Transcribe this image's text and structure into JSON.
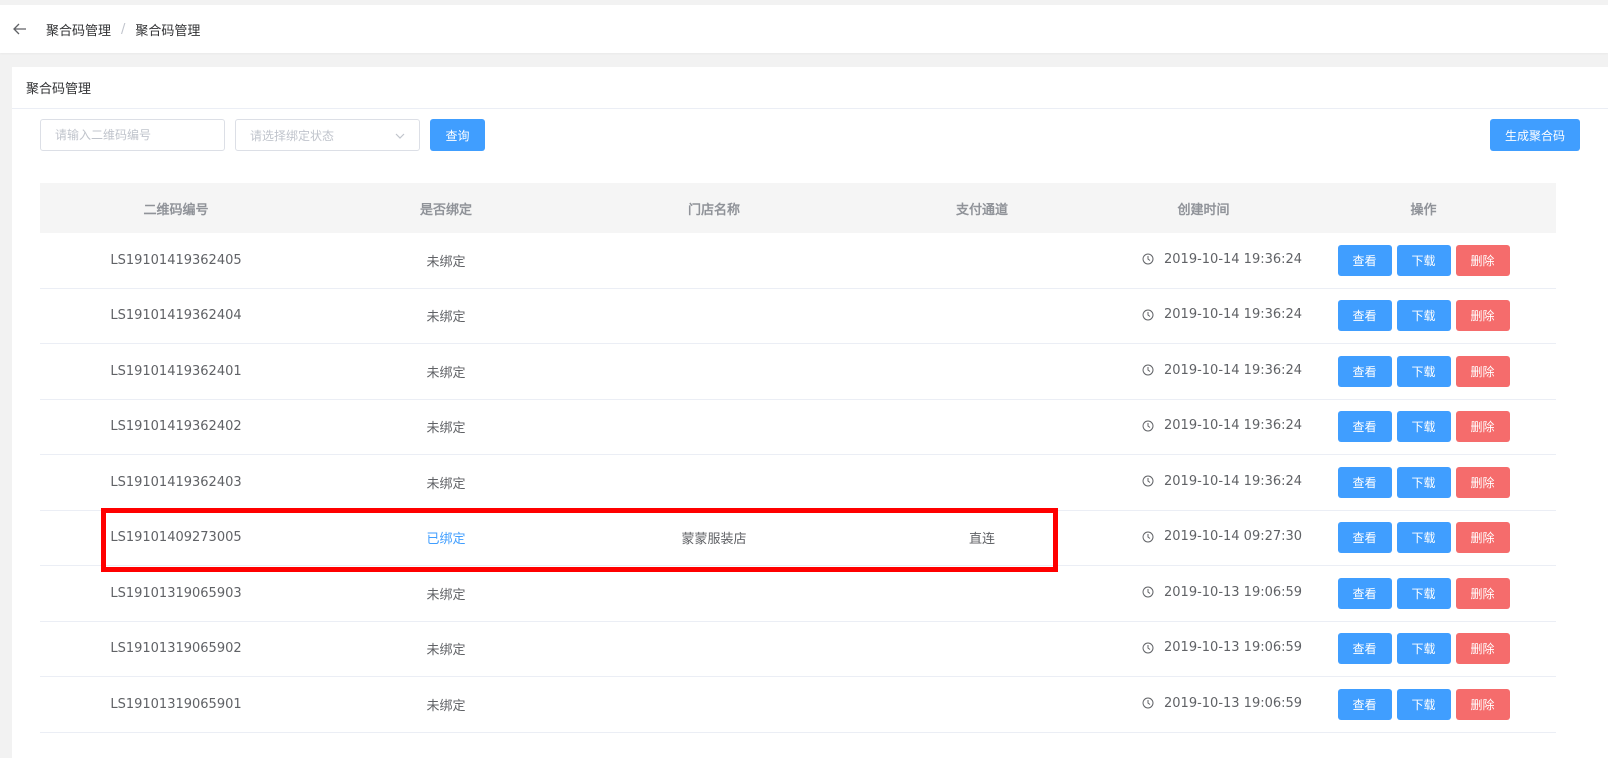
{
  "breadcrumb": {
    "items": [
      "聚合码管理",
      "聚合码管理"
    ],
    "separator": "/"
  },
  "card": {
    "title": "聚合码管理"
  },
  "filters": {
    "code_placeholder": "请输入二维码编号",
    "status_placeholder": "请选择绑定状态",
    "query_label": "查询",
    "generate_label": "生成聚合码"
  },
  "table": {
    "headers": [
      "二维码编号",
      "是否绑定",
      "门店名称",
      "支付通道",
      "创建时间",
      "操作"
    ],
    "rows": [
      {
        "code": "LS19101419362405",
        "status": "未绑定",
        "store": "",
        "channel": "",
        "created": "2019-10-14 19:36:24"
      },
      {
        "code": "LS19101419362404",
        "status": "未绑定",
        "store": "",
        "channel": "",
        "created": "2019-10-14 19:36:24"
      },
      {
        "code": "LS19101419362401",
        "status": "未绑定",
        "store": "",
        "channel": "",
        "created": "2019-10-14 19:36:24"
      },
      {
        "code": "LS19101419362402",
        "status": "未绑定",
        "store": "",
        "channel": "",
        "created": "2019-10-14 19:36:24"
      },
      {
        "code": "LS19101419362403",
        "status": "未绑定",
        "store": "",
        "channel": "",
        "created": "2019-10-14 19:36:24"
      },
      {
        "code": "LS19101409273005",
        "status": "已绑定",
        "store": "蒙蒙服装店",
        "channel": "直连",
        "created": "2019-10-14 09:27:30"
      },
      {
        "code": "LS19101319065903",
        "status": "未绑定",
        "store": "",
        "channel": "",
        "created": "2019-10-13 19:06:59"
      },
      {
        "code": "LS19101319065902",
        "status": "未绑定",
        "store": "",
        "channel": "",
        "created": "2019-10-13 19:06:59"
      },
      {
        "code": "LS19101319065901",
        "status": "未绑定",
        "store": "",
        "channel": "",
        "created": "2019-10-13 19:06:59"
      }
    ],
    "actions": {
      "view": "查看",
      "download": "下载",
      "delete": "删除"
    }
  },
  "colors": {
    "primary": "#409eff",
    "danger": "#f56c6c",
    "highlight": "#ff0000"
  },
  "icons": {
    "back": "arrow-left-icon",
    "dropdown": "chevron-down-icon",
    "time": "clock-icon"
  }
}
